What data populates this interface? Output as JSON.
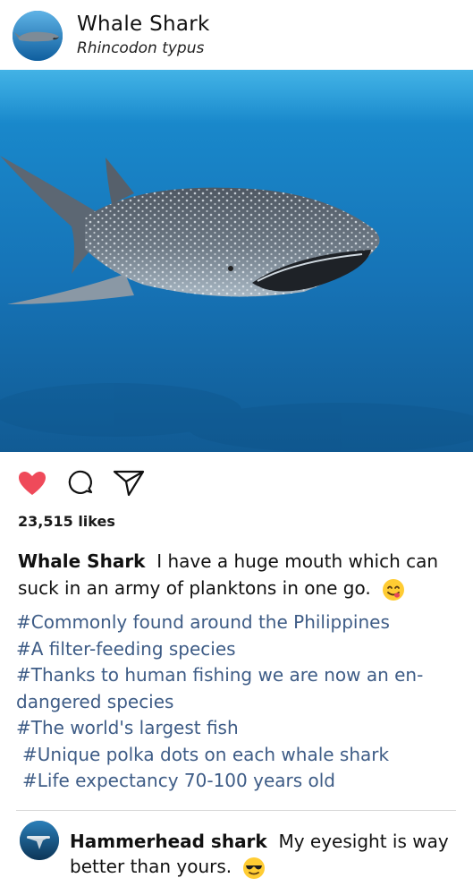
{
  "post": {
    "account_name": "Whale Shark",
    "account_subtitle": "Rhincodon typus",
    "photo_icon": "whale-shark-photo",
    "likes": "23,515 likes",
    "liked": true,
    "like_color": "#ef4a5a",
    "tag_color": "#3e5c86",
    "caption": {
      "author": "Whale Shark",
      "text": "I have a huge mouth which can suck in an army of planktons in one go.",
      "emoji": "yum-face-emoji"
    },
    "hashtags": [
      "#Commonly found around the Philippines",
      "#A filter-feeding species",
      "#Thanks to human fishing we are now an en-",
      "dangered species",
      "#The world's largest fish",
      "#Unique polka dots on each whale shark",
      "#Life expectancy 70-100 years old"
    ]
  },
  "comments": [
    {
      "author": "Hammerhead shark",
      "text": "My eyesight is way better than yours.",
      "emoji": "sunglasses-face-emoji",
      "avatar_icon": "hammerhead-shark-avatar"
    }
  ]
}
